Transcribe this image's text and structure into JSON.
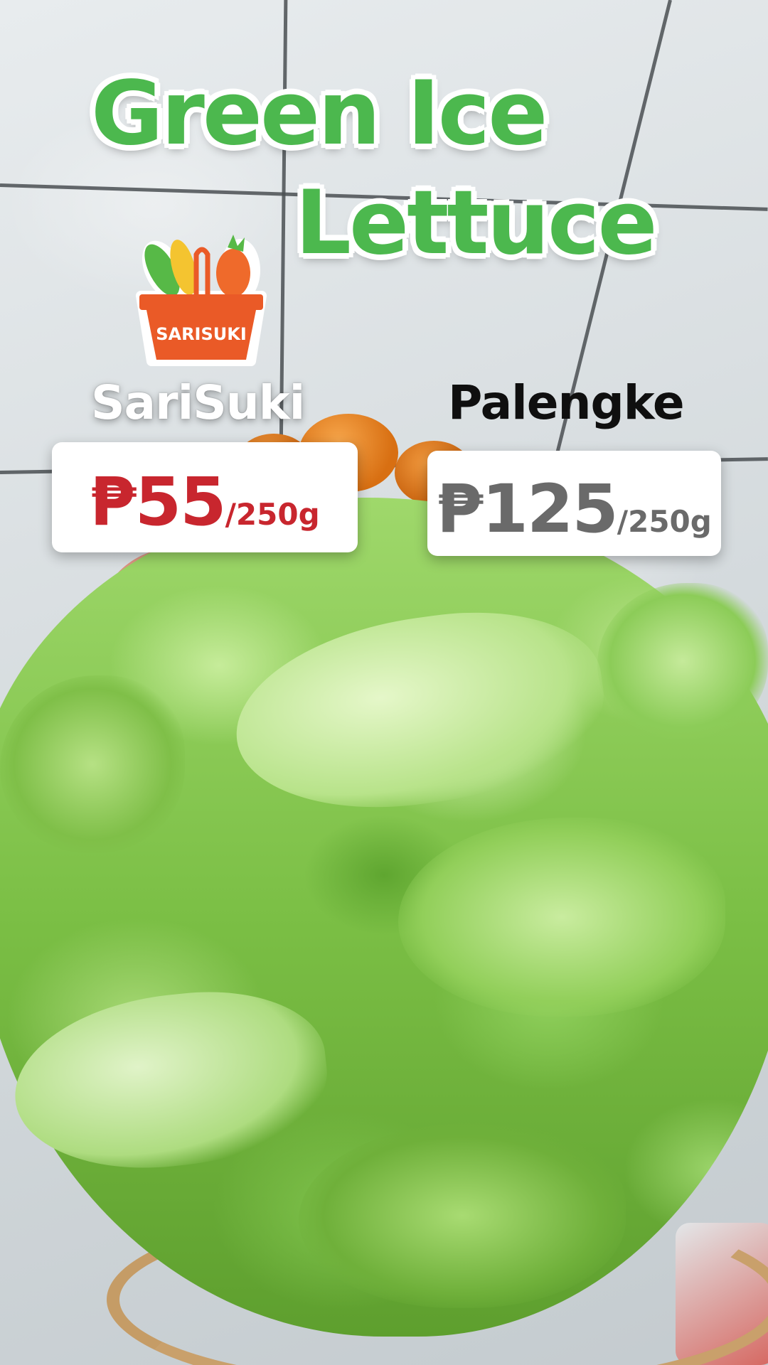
{
  "title": {
    "line1": "Green Ice",
    "line2": "Lettuce",
    "color": "#4cb84e"
  },
  "logo": {
    "text": "SARISUKI",
    "colors": {
      "basket": "#ea5a27",
      "leaf": "#57b947",
      "corn": "#f4c430"
    }
  },
  "comparison": {
    "sarisuki": {
      "label": "SariSuki",
      "price": "₱55",
      "unit": "/250g",
      "price_color": "#c8262e"
    },
    "palengke": {
      "label": "Palengke",
      "price": "₱125",
      "unit": "/250g",
      "price_color": "#6a6a6a"
    }
  }
}
